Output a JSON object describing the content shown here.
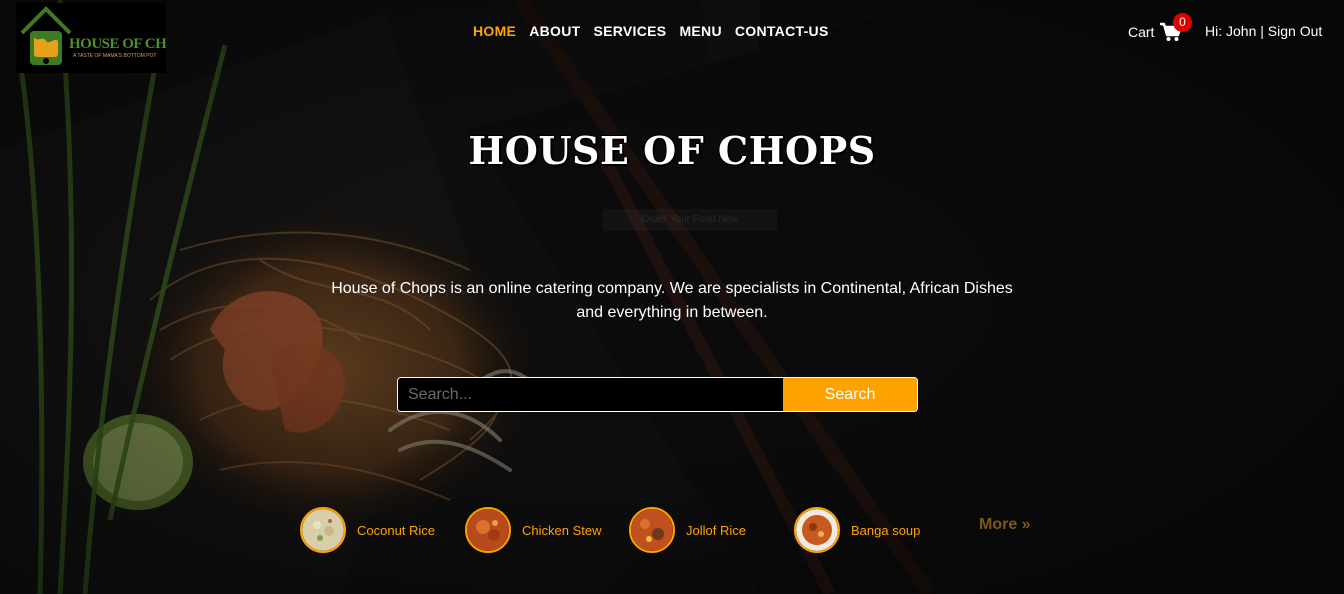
{
  "brand": {
    "logo_title": "HOUSE OF CHOPS",
    "logo_tagline": "A TASTE OF MAMA'S BOTTOM POT"
  },
  "nav": {
    "items": [
      {
        "label": "HOME",
        "active": true
      },
      {
        "label": "ABOUT",
        "active": false
      },
      {
        "label": "SERVICES",
        "active": false
      },
      {
        "label": "MENU",
        "active": false
      },
      {
        "label": "CONTACT-US",
        "active": false
      }
    ]
  },
  "header": {
    "cart_label": "Cart",
    "cart_count": "0",
    "greeting": "Hi: John",
    "separator": "|",
    "sign_out": "Sign Out"
  },
  "hero": {
    "title": "HOUSE OF CHOPS",
    "faint_text": "Order Your Food Now",
    "intro": "House of Chops is an online catering company. We are specialists in Continental, African Dishes and everything in between."
  },
  "search": {
    "placeholder": "Search...",
    "button_label": "Search"
  },
  "dishes": [
    {
      "name": "Coconut Rice"
    },
    {
      "name": "Chicken Stew"
    },
    {
      "name": "Jollof Rice"
    },
    {
      "name": "Banga soup"
    }
  ],
  "more_label": "More »",
  "colors": {
    "accent": "#ffa200",
    "badge": "#e00000",
    "background": "#121212"
  }
}
